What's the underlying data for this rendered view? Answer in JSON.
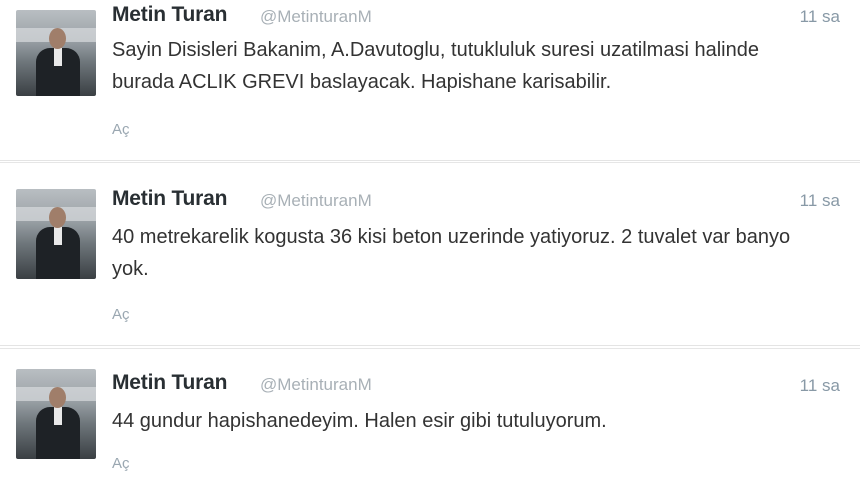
{
  "tweets": [
    {
      "name": "Metin Turan",
      "handle": "@MetinturanM",
      "time": "11 sa",
      "text": "Sayin Disisleri Bakanim, A.Davutoglu, tutukluluk suresi uzatilmasi halinde burada ACLIK GREVI baslayacak. Hapishane karisabilir.",
      "action": "Aç"
    },
    {
      "name": "Metin Turan",
      "handle": "@MetinturanM",
      "time": "11 sa",
      "text": "40 metrekarelik kogusta 36 kisi beton uzerinde yatiyoruz. 2 tuvalet var banyo yok.",
      "action": "Aç"
    },
    {
      "name": "Metin Turan",
      "handle": "@MetinturanM",
      "time": "11 sa",
      "text": "44 gundur hapishanedeyim. Halen esir gibi tutuluyorum.",
      "action": "Aç"
    }
  ],
  "icons": {
    "avatar": "profile-photo"
  },
  "colors": {
    "name": "#292f33",
    "handle": "#a8b0b6",
    "text": "#333333",
    "meta": "#8899a6",
    "divider": "#e4e4e4"
  }
}
